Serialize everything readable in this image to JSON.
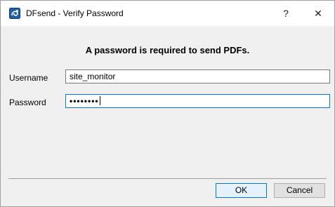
{
  "window": {
    "title": "DFsend - Verify Password",
    "help_glyph": "?",
    "close_glyph": "✕"
  },
  "dialog": {
    "heading": "A password is required to send PDFs.",
    "username_label": "Username",
    "username_value": "site_monitor",
    "password_label": "Password",
    "password_masked": "••••••••"
  },
  "buttons": {
    "ok_label": "OK",
    "cancel_label": "Cancel"
  },
  "icons": {
    "app": "dfsend-app-icon"
  },
  "colors": {
    "accent": "#0078d7",
    "icon_blue": "#1e5faa"
  }
}
